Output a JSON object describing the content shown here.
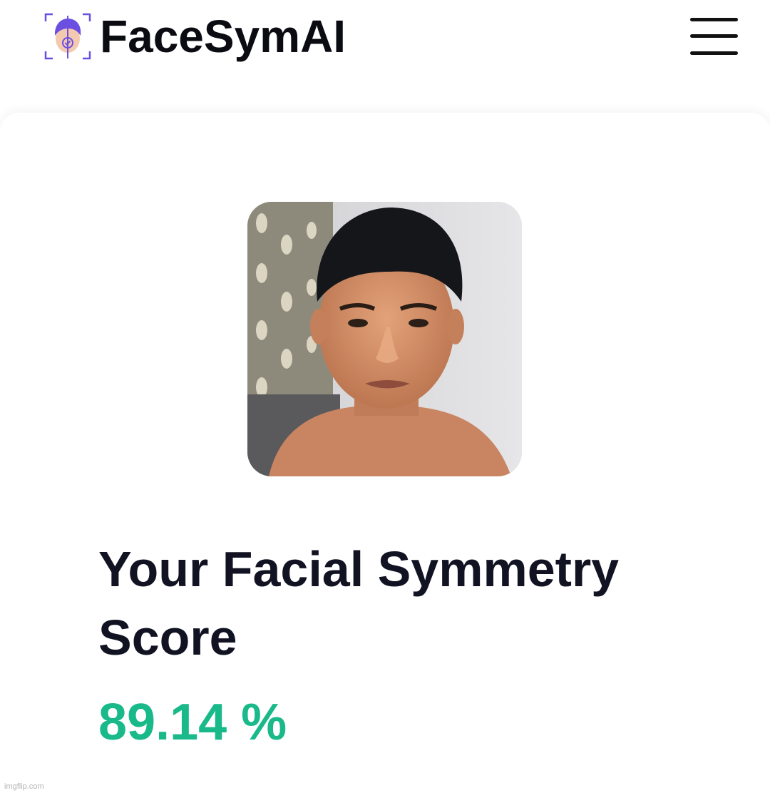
{
  "header": {
    "brand_name": "FaceSymAI",
    "logo_icon": "face-scan-logo-icon",
    "menu_icon": "hamburger-menu-icon"
  },
  "result": {
    "photo_alt": "Uploaded face photo",
    "title": "Your Facial Symmetry Score",
    "score": "89.14 %",
    "score_percent": 89.14
  },
  "watermark": "imgflip.com",
  "colors": {
    "accent_score": "#19b98a",
    "logo_purple": "#6b4fe0",
    "text_dark": "#111322"
  }
}
